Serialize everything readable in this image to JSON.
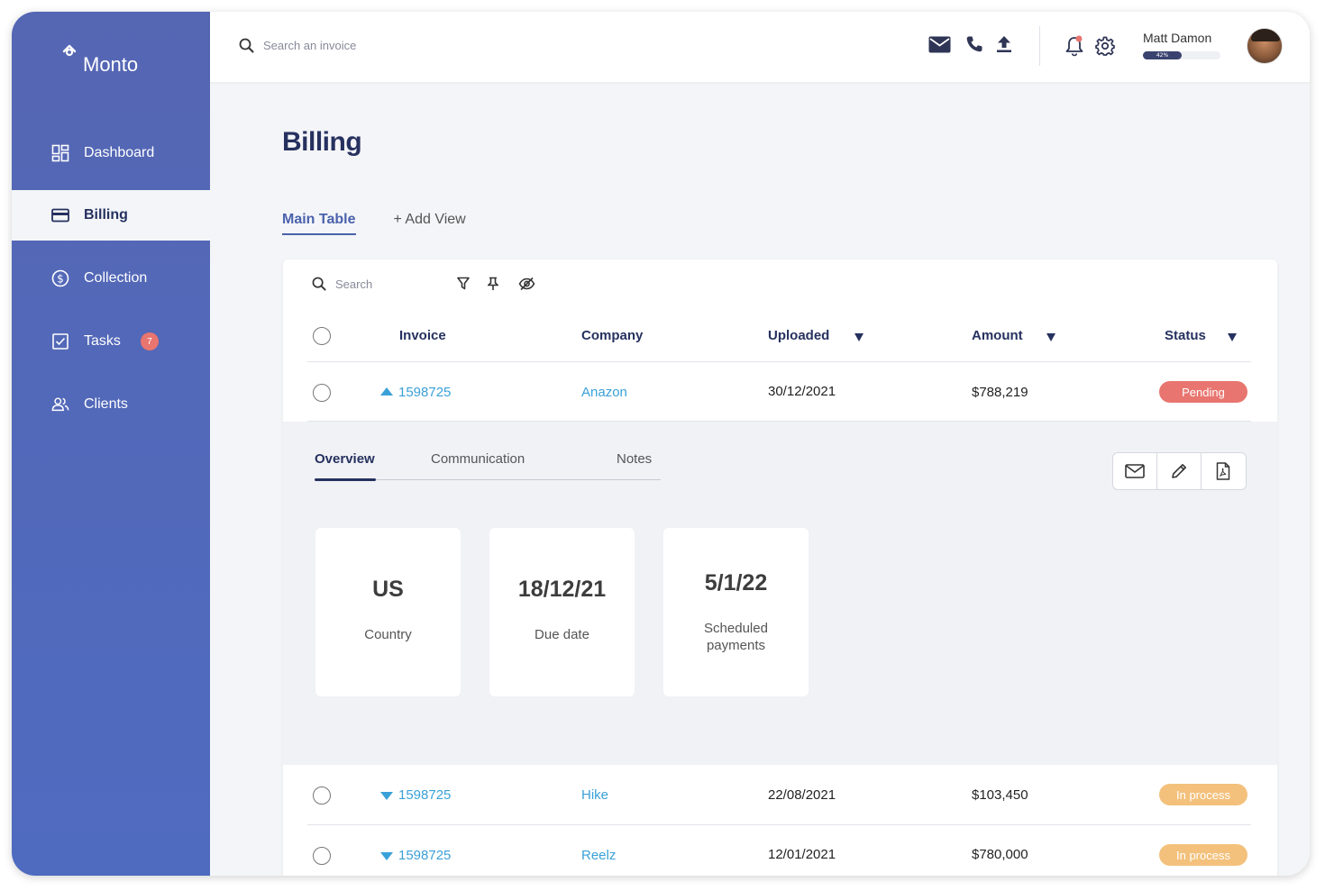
{
  "app": {
    "logo_text": "Monto"
  },
  "sidebar": {
    "items": [
      {
        "label": "Dashboard",
        "icon": "dashboard-icon"
      },
      {
        "label": "Billing",
        "icon": "credit-card-icon",
        "active": true
      },
      {
        "label": "Collection",
        "icon": "dollar-circle-icon"
      },
      {
        "label": "Tasks",
        "icon": "checkbox-icon",
        "badge": "7"
      },
      {
        "label": "Clients",
        "icon": "users-icon"
      }
    ]
  },
  "topbar": {
    "search_placeholder": "Search an invoice",
    "icons": [
      "mail-icon",
      "phone-icon",
      "upload-icon",
      "bell-icon",
      "gear-icon"
    ],
    "user": {
      "name": "Matt Damon",
      "progress_label": "42%",
      "progress_value": 0.5
    }
  },
  "page": {
    "title": "Billing",
    "tabs": {
      "main": "Main Table",
      "add": "+ Add View"
    }
  },
  "table": {
    "search_placeholder": "Search",
    "columns": {
      "invoice": "Invoice",
      "company": "Company",
      "uploaded": "Uploaded",
      "amount": "Amount",
      "status": "Status"
    },
    "rows": [
      {
        "invoice": "1598725",
        "company": "Anazon",
        "uploaded": "30/12/2021",
        "amount": "$788,219",
        "status": "Pending",
        "status_color": "#e8756f",
        "expanded": true
      },
      {
        "invoice": "1598725",
        "company": "Hike",
        "uploaded": "22/08/2021",
        "amount": "$103,450",
        "status": "In process",
        "status_color": "#f3c17c",
        "expanded": false
      },
      {
        "invoice": "1598725",
        "company": "Reelz",
        "uploaded": "12/01/2021",
        "amount": "$780,000",
        "status": "In process",
        "status_color": "#f3c17c",
        "expanded": false
      }
    ]
  },
  "detail": {
    "tabs": {
      "overview": "Overview",
      "communication": "Communication",
      "notes": "Notes"
    },
    "cards": [
      {
        "value": "US",
        "label": "Country"
      },
      {
        "value": "18/12/21",
        "label": "Due date"
      },
      {
        "value": "5/1/22",
        "label": "Scheduled payments"
      }
    ]
  },
  "colors": {
    "sidebar": "#5566b3",
    "accent": "#4a62ad",
    "link": "#3aa0d8",
    "pending": "#e8756f",
    "in_process": "#f3c17c"
  }
}
